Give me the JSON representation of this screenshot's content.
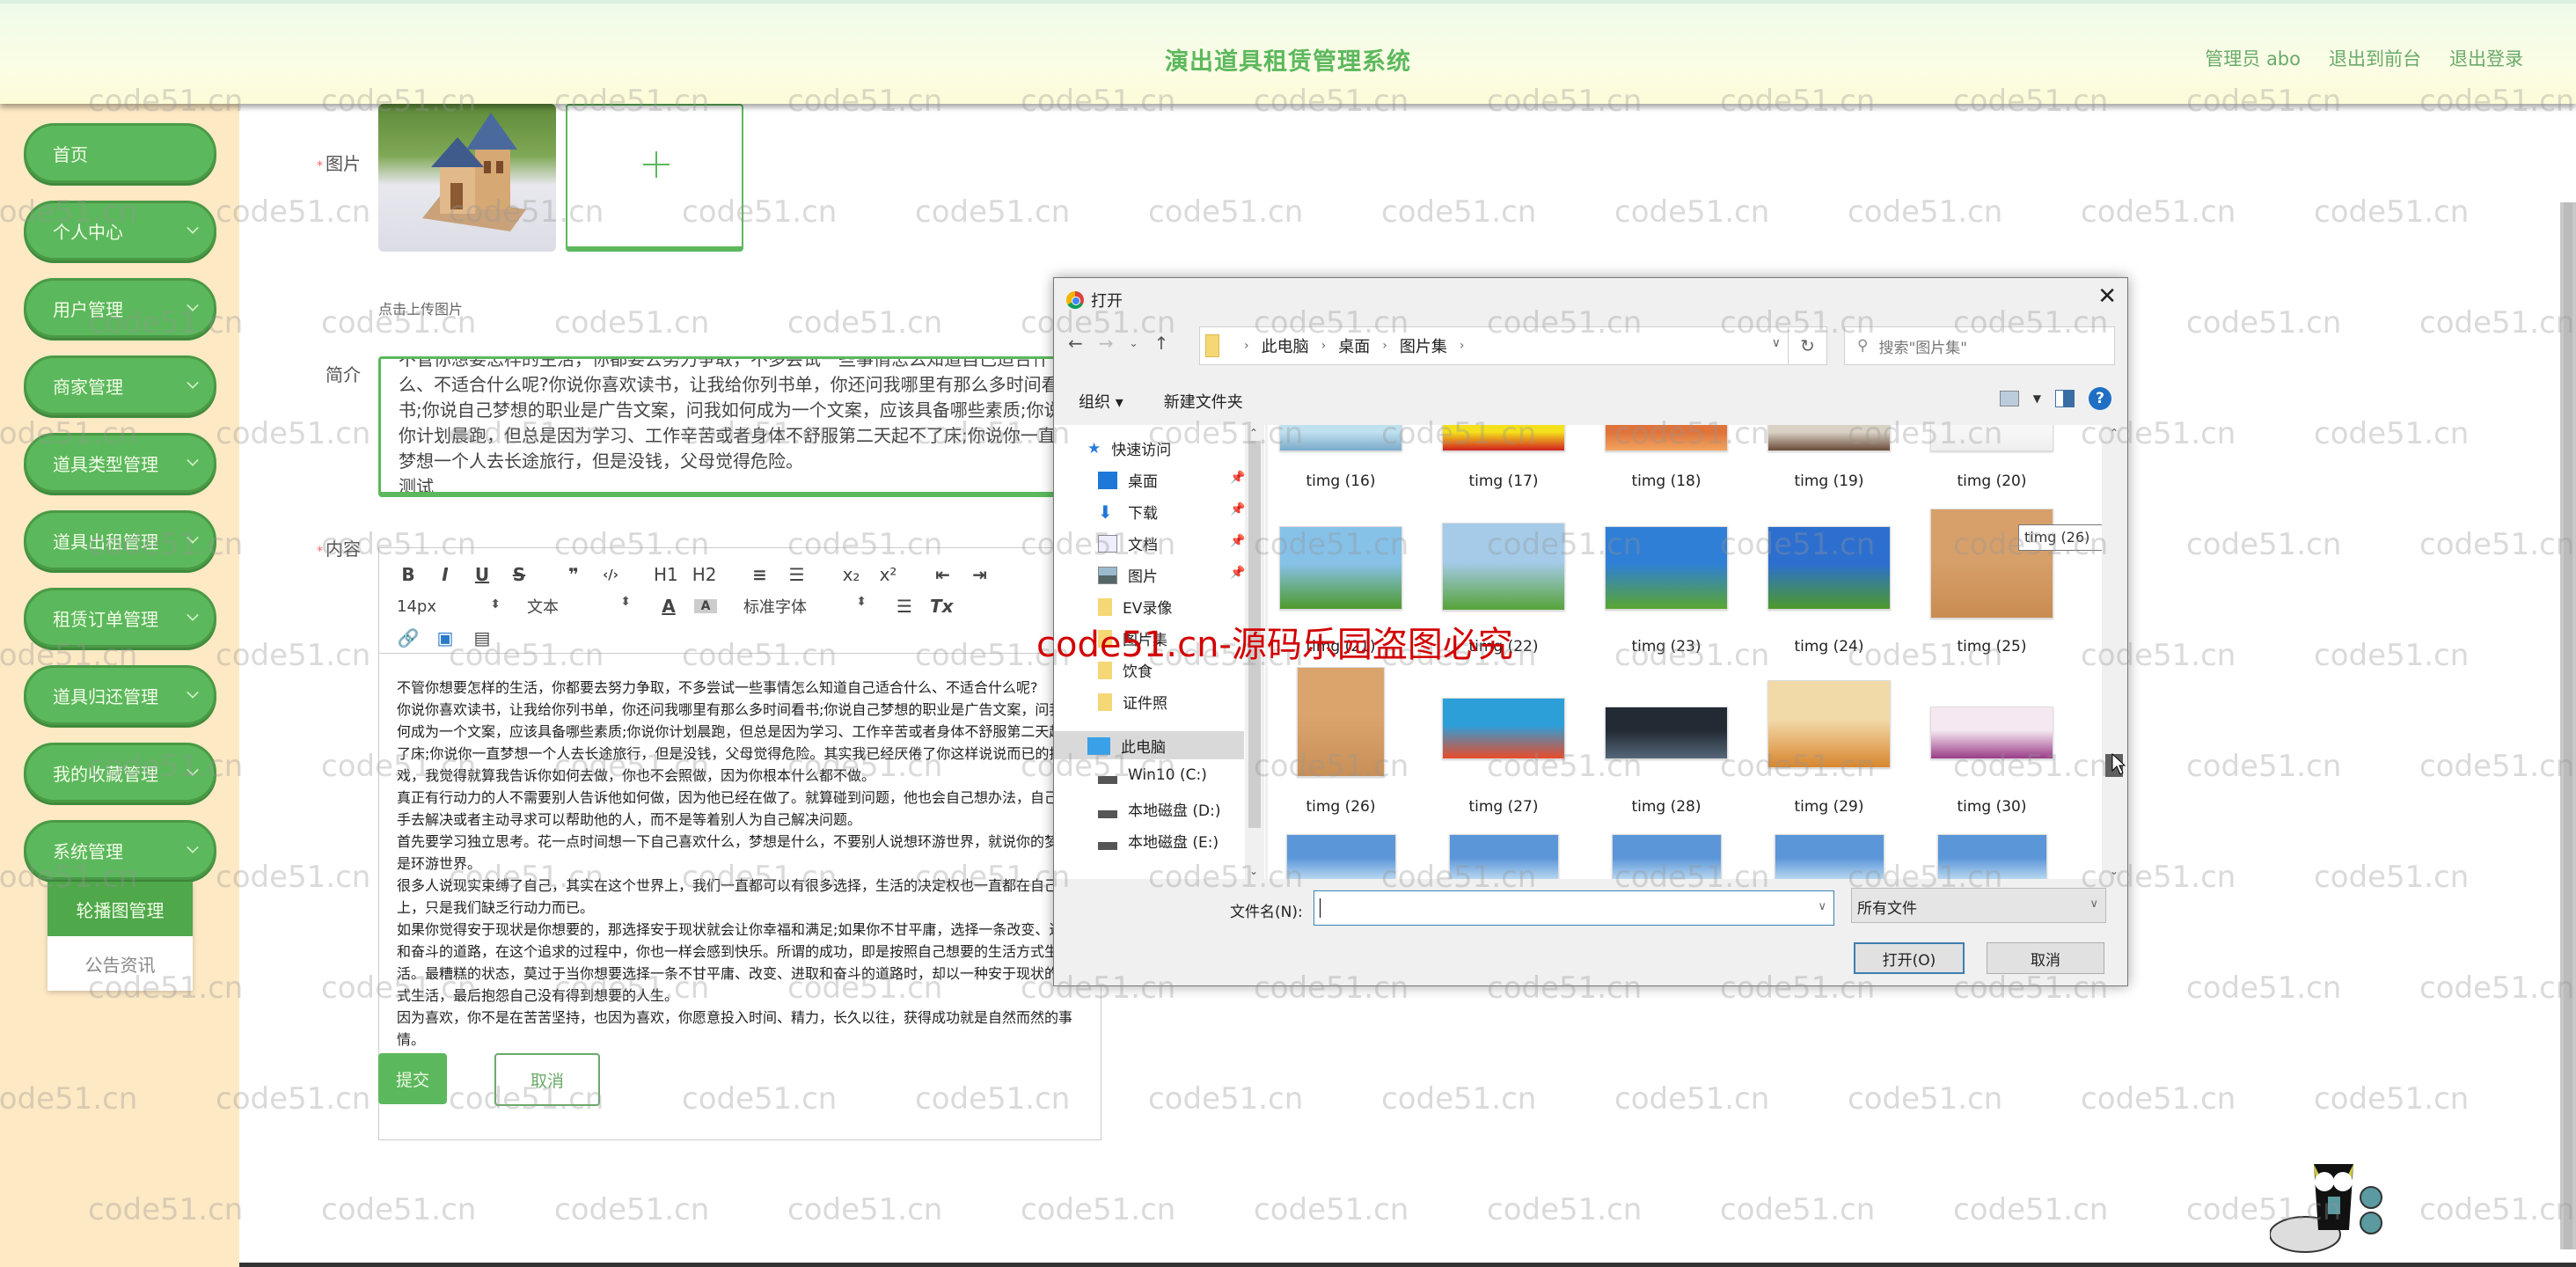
{
  "header": {
    "title": "演出道具租赁管理系统",
    "user_label": "管理员 abo",
    "to_front": "退出到前台",
    "logout": "退出登录"
  },
  "sidebar": {
    "items": [
      {
        "label": "首页",
        "has_children": false
      },
      {
        "label": "个人中心",
        "has_children": true
      },
      {
        "label": "用户管理",
        "has_children": true
      },
      {
        "label": "商家管理",
        "has_children": true
      },
      {
        "label": "道具类型管理",
        "has_children": true
      },
      {
        "label": "道具出租管理",
        "has_children": true
      },
      {
        "label": "租赁订单管理",
        "has_children": true
      },
      {
        "label": "道具归还管理",
        "has_children": true
      },
      {
        "label": "我的收藏管理",
        "has_children": true
      },
      {
        "label": "系统管理",
        "has_children": true
      }
    ],
    "submenu": [
      {
        "label": "轮播图管理",
        "active": true
      },
      {
        "label": "公告资讯",
        "active": false
      }
    ]
  },
  "form": {
    "image_label": "图片",
    "upload_hint": "点击上传图片",
    "intro_label": "简介",
    "intro_value": "不管你想要怎样的生活，你都要去努力争取，不多尝试一些事情怎么知道自己适合什么、不适合什么呢?你说你喜欢读书，让我给你列书单，你还问我哪里有那么多时间看书;你说自己梦想的职业是广告文案，问我如何成为一个文案，应该具备哪些素质;你说你计划晨跑，但总是因为学习、工作辛苦或者身体不舒服第二天起不了床;你说你一直梦想一个人去长途旅行，但是没钱，父母觉得危险。\n测试",
    "content_label": "内容",
    "editor": {
      "toolbar_row1": [
        "B",
        "I",
        "U",
        "S",
        "❞",
        "‹/›",
        "H1",
        "H2",
        "≡",
        "☰",
        "x₂",
        "x²",
        "⇤",
        "⇥"
      ],
      "font_size": "14px",
      "block_type": "文本",
      "font_family": "标准字体",
      "paragraphs": [
        "不管你想要怎样的生活，你都要去努力争取，不多尝试一些事情怎么知道自己适合什么、不适合什么呢?",
        "你说你喜欢读书，让我给你列书单，你还问我哪里有那么多时间看书;你说自己梦想的职业是广告文案，问我如何成为一个文案，应该具备哪些素质;你说你计划晨跑，但总是因为学习、工作辛苦或者身体不舒服第二天起不了床;你说你一直梦想一个人去长途旅行，但是没钱，父母觉得危险。其实我已经厌倦了你这样说说而已的把戏，我觉得就算我告诉你如何去做，你也不会照做，因为你根本什么都不做。",
        "真正有行动力的人不需要别人告诉他如何做，因为他已经在做了。就算碰到问题，他也会自己想办法，自己动手去解决或者主动寻求可以帮助他的人，而不是等着别人为自己解决问题。",
        "首先要学习独立思考。花一点时间想一下自己喜欢什么，梦想是什么，不要别人说想环游世界，就说你的梦想是环游世界。",
        "很多人说现实束缚了自己，其实在这个世界上，我们一直都可以有很多选择，生活的决定权也一直都在自己手上，只是我们缺乏行动力而已。",
        "如果你觉得安于现状是你想要的，那选择安于现状就会让你幸福和满足;如果你不甘平庸，选择一条改变、进取和奋斗的道路，在这个追求的过程中，你也一样会感到快乐。所谓的成功，即是按照自己想要的生活方式生活。最糟糕的状态，莫过于当你想要选择一条不甘平庸、改变、进取和奋斗的道路时，却以一种安于现状的方式生活，最后抱怨自己没有得到想要的人生。",
        "因为喜欢，你不是在苦苦坚持，也因为喜欢，你愿意投入时间、精力，长久以往，获得成功就是自然而然的事情。"
      ]
    },
    "submit": "提交",
    "cancel": "取消"
  },
  "dialog": {
    "title": "打开",
    "breadcrumb": [
      "此电脑",
      "桌面",
      "图片集"
    ],
    "search_placeholder": "搜索\"图片集\"",
    "organize": "组织 ▾",
    "new_folder": "新建文件夹",
    "nav_pane": {
      "quick_access": "快速访问",
      "pinned": [
        {
          "label": "桌面",
          "icon": "desktop-icon"
        },
        {
          "label": "下载",
          "icon": "download-icon"
        },
        {
          "label": "文档",
          "icon": "document-icon"
        },
        {
          "label": "图片",
          "icon": "pictures-icon"
        }
      ],
      "folders": [
        "EV录像",
        "图片集",
        "饮食",
        "证件照"
      ],
      "this_pc": "此电脑",
      "drives": [
        "Win10 (C:)",
        "本地磁盘 (D:)",
        "本地磁盘 (E:)"
      ]
    },
    "files": [
      {
        "name": "timg (16)",
        "colors": [
          "#bfe0ef",
          "#7aa9c9"
        ]
      },
      {
        "name": "timg (17)",
        "colors": [
          "#f4e11c",
          "#d22020"
        ]
      },
      {
        "name": "timg (18)",
        "colors": [
          "#e0733a",
          "#f2a55e"
        ]
      },
      {
        "name": "timg (19)",
        "colors": [
          "#d9d2c4",
          "#6b4a3a"
        ]
      },
      {
        "name": "timg (20)",
        "colors": [
          "#f7f7f7",
          "#eeeeee"
        ]
      },
      {
        "name": "timg (21)",
        "colors": [
          "#86c1e8",
          "#4e9a2c"
        ]
      },
      {
        "name": "timg (22)",
        "colors": [
          "#a5cbe8",
          "#57a33a"
        ]
      },
      {
        "name": "timg (23)",
        "colors": [
          "#2f7fd6",
          "#5aa631"
        ]
      },
      {
        "name": "timg (24)",
        "colors": [
          "#2c6fcf",
          "#4d9a2a"
        ]
      },
      {
        "name": "timg (25)",
        "colors": [
          "#d7a06a",
          "#c98c52"
        ]
      },
      {
        "name": "timg (26)",
        "colors": [
          "#d9a56d",
          "#c98f57"
        ]
      },
      {
        "name": "timg (27)",
        "colors": [
          "#2d9fd8",
          "#e84b2a"
        ]
      },
      {
        "name": "timg (28)",
        "colors": [
          "#222a33",
          "#55677a"
        ]
      },
      {
        "name": "timg (29)",
        "colors": [
          "#f2d9a8",
          "#d8862e"
        ]
      },
      {
        "name": "timg (30)",
        "colors": [
          "#f5e8f0",
          "#9a3c88"
        ]
      },
      {
        "name": "",
        "colors": [
          "#5b96d8",
          "#d6ecf8"
        ]
      },
      {
        "name": "",
        "colors": [
          "#5b96d8",
          "#d6ecf8"
        ]
      },
      {
        "name": "",
        "colors": [
          "#5b96d8",
          "#d6ecf8"
        ]
      },
      {
        "name": "",
        "colors": [
          "#5b96d8",
          "#d6ecf8"
        ]
      },
      {
        "name": "",
        "colors": [
          "#5b96d8",
          "#d6ecf8"
        ]
      }
    ],
    "tooltip": "timg (26)",
    "filename_label": "文件名(N):",
    "filename_value": "",
    "filetype": "所有文件",
    "open_button": "打开(O)",
    "cancel_button": "取消"
  },
  "watermark": {
    "small": "code51.cn",
    "big": "code51.cn-源码乐园盗图必究"
  },
  "colors": {
    "accent": "#5cb85c",
    "sidebar_bg": "#fde9c4",
    "watermark_red": "#d20000"
  }
}
